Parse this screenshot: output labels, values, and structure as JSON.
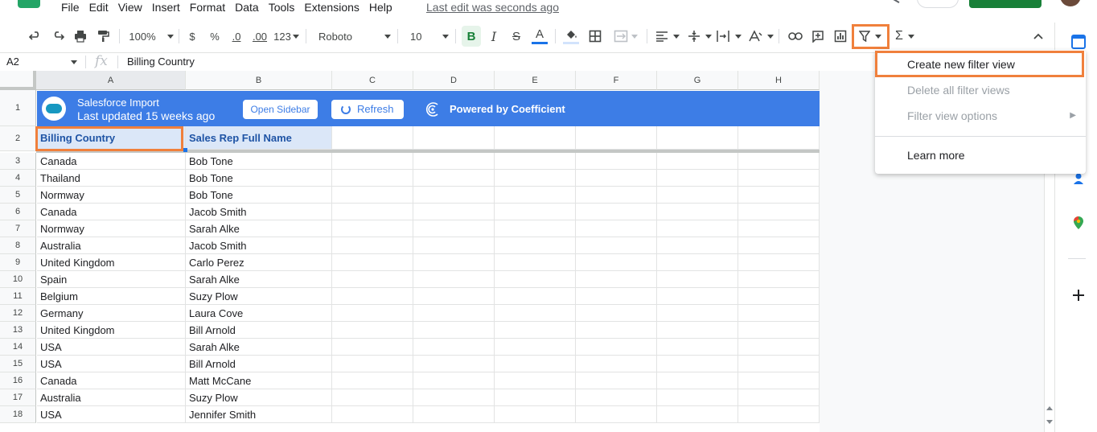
{
  "menu": {
    "items": [
      "File",
      "Edit",
      "View",
      "Insert",
      "Format",
      "Data",
      "Tools",
      "Extensions",
      "Help"
    ],
    "last_edit": "Last edit was seconds ago"
  },
  "toolbar": {
    "zoom": "100%",
    "currency": "$",
    "percent": "%",
    "dec_decrease": ".0",
    "dec_increase": ".00",
    "more_formats": "123",
    "font": "Roboto",
    "font_size": "10",
    "bold": "B",
    "italic": "I",
    "strike": "S",
    "text_color": "A",
    "sum": "Σ"
  },
  "formula_bar": {
    "cell_ref": "A2",
    "fx": "fx",
    "value": "Billing Country"
  },
  "columns": [
    "A",
    "B",
    "C",
    "D",
    "E",
    "F",
    "G",
    "H"
  ],
  "banner": {
    "title": "Salesforce Import",
    "subtitle": "Last updated 15 weeks ago",
    "open_sidebar": "Open Sidebar",
    "refresh": "Refresh",
    "powered_by": "Powered by Coefficient"
  },
  "headers": [
    "Billing Country",
    "Sales Rep Full Name"
  ],
  "rows": [
    {
      "num": "3",
      "country": "Canada",
      "rep": "Bob Tone"
    },
    {
      "num": "4",
      "country": "Thailand",
      "rep": "Bob Tone"
    },
    {
      "num": "5",
      "country": "Normway",
      "rep": "Bob Tone"
    },
    {
      "num": "6",
      "country": "Canada",
      "rep": "Jacob Smith"
    },
    {
      "num": "7",
      "country": "Normway",
      "rep": "Sarah Alke"
    },
    {
      "num": "8",
      "country": "Australia",
      "rep": "Jacob Smith"
    },
    {
      "num": "9",
      "country": "United Kingdom",
      "rep": "Carlo Perez"
    },
    {
      "num": "10",
      "country": "Spain",
      "rep": "Sarah Alke"
    },
    {
      "num": "11",
      "country": "Belgium",
      "rep": "Suzy Plow"
    },
    {
      "num": "12",
      "country": "Germany",
      "rep": "Laura Cove"
    },
    {
      "num": "13",
      "country": "United Kingdom",
      "rep": "Bill Arnold"
    },
    {
      "num": "14",
      "country": "USA",
      "rep": "Sarah Alke"
    },
    {
      "num": "15",
      "country": "USA",
      "rep": "Bill Arnold"
    },
    {
      "num": "16",
      "country": "Canada",
      "rep": "Matt McCane"
    },
    {
      "num": "17",
      "country": "Australia",
      "rep": "Suzy Plow"
    },
    {
      "num": "18",
      "country": "USA",
      "rep": "Jennifer Smith"
    }
  ],
  "row_numbers": {
    "banner": "1",
    "header": "2"
  },
  "filter_menu": {
    "create": "Create new filter view",
    "delete_all": "Delete all filter views",
    "options": "Filter view options",
    "learn_more": "Learn more"
  },
  "colors": {
    "banner": "#3d7de6",
    "highlight": "#f0803c",
    "header_fill": "#dbe7f8",
    "share_green": "#188038"
  }
}
